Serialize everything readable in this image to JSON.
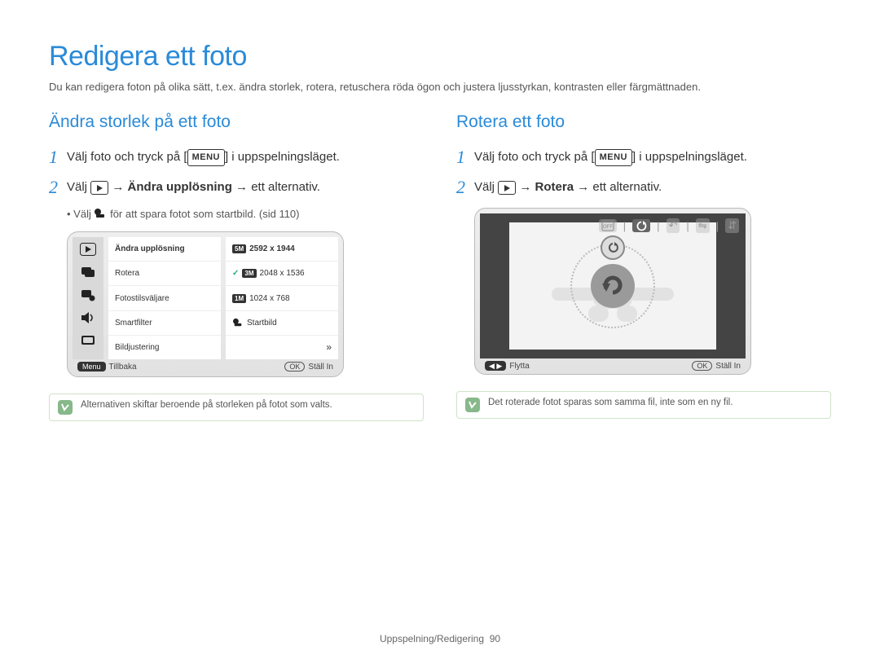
{
  "page": {
    "title": "Redigera ett foto",
    "intro": "Du kan redigera foton på olika sätt, t.ex. ändra storlek, rotera, retuschera röda ögon och justera ljusstyrkan, kontrasten eller färgmättnaden.",
    "footer_label": "Uppspelning/Redigering",
    "footer_page": "90"
  },
  "menu_label": "MENU",
  "left": {
    "heading": "Ändra storlek på ett foto",
    "step1_a": "Välj foto och tryck på [",
    "step1_b": "] i uppspelningsläget.",
    "step2_a": "Välj ",
    "step2_b": " → ",
    "step2_bold": "Ändra upplösning",
    "step2_c": " → ett alternativ.",
    "bullet_a": "Välj ",
    "bullet_b": " för att spara fotot som startbild. (sid 110)",
    "cam": {
      "menu_left": [
        "Ändra upplösning",
        "Rotera",
        "Fotostilsväljare",
        "Smartfilter",
        "Bildjustering"
      ],
      "menu_right": [
        {
          "icon": "5M",
          "label": "2592 x 1944"
        },
        {
          "icon": "3M",
          "label": "2048 x 1536",
          "checked": true
        },
        {
          "icon": "1M",
          "label": "1024 x 768"
        },
        {
          "icon": "start",
          "label": "Startbild"
        }
      ],
      "footer_left_badge": "Menu",
      "footer_left_text": "Tillbaka",
      "footer_right_badge": "OK",
      "footer_right_text": "Ställ In"
    },
    "note": "Alternativen skiftar beroende på storleken på fotot som valts."
  },
  "right": {
    "heading": "Rotera ett foto",
    "step1_a": "Välj foto och tryck på [",
    "step1_b": "] i uppspelningsläget.",
    "step2_a": "Välj ",
    "step2_b": " → ",
    "step2_bold": "Rotera",
    "step2_c": " → ett alternativ.",
    "cam": {
      "footer_left_text": "Flytta",
      "footer_right_badge": "OK",
      "footer_right_text": "Ställ In"
    },
    "note": "Det roterade fotot sparas som samma fil, inte som en ny fil."
  }
}
